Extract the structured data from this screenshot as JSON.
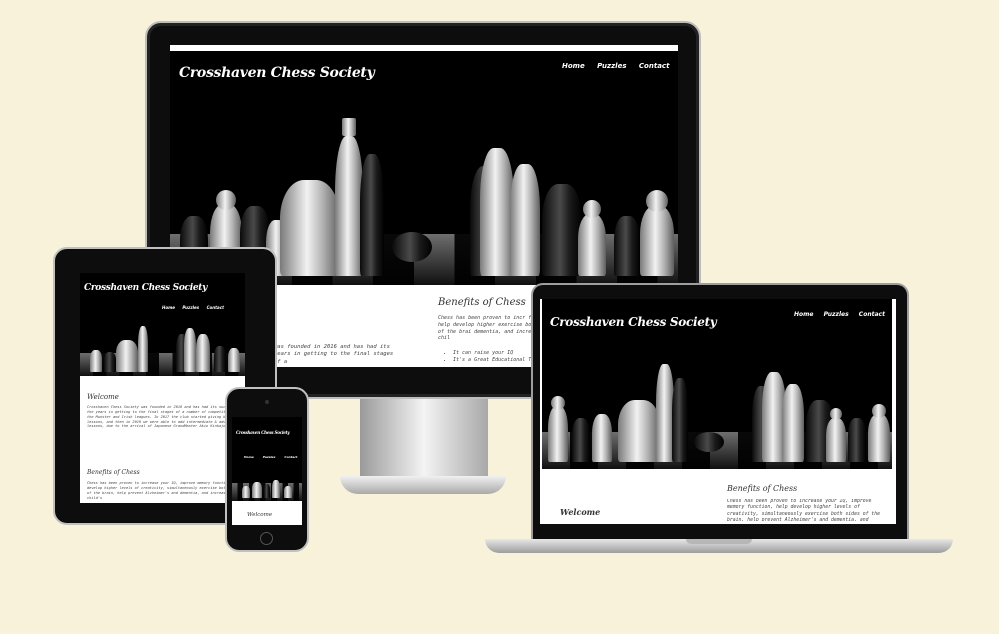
{
  "site": {
    "title": "Crosshaven Chess Society",
    "nav": [
      "Home",
      "Puzzles",
      "Contact"
    ]
  },
  "sections": {
    "welcome_heading": "Welcome",
    "welcome_text": "Crosshaven Chess Society was founded in 2016 and has had its success over the years in getting to the final stages of a number of competitions in the Munster and Irish leagues. In 2017 the club started giving beginner lessons, and then in 2019 we were able to add intermediate & advanced lessons, due to the arrival of Japanese GrandMaster Akio Kinkajoshi.",
    "monitor_welcome_fragment": "was founded in 2016 and has had its years in getting to the final stages of a",
    "benefits_heading": "Benefits of Chess",
    "benefits_text": "Chess has been proven to increase your IQ, improve memory function, help develop higher levels of creativity, simultaneously exercise both sides of the brain, help prevent Alzheimer's and dementia, and increase a child's",
    "monitor_benefits_fragment": "Chess has been proven to incr function, help develop higher exercise both sides of the brai dementia, and increase a chil",
    "benefits_list": [
      "It can raise your IQ",
      "It's a Great Educational Tool"
    ]
  },
  "colors": {
    "background": "#f9f2da",
    "device_frame": "#0d0d0d",
    "hero_bg": "#000000"
  }
}
